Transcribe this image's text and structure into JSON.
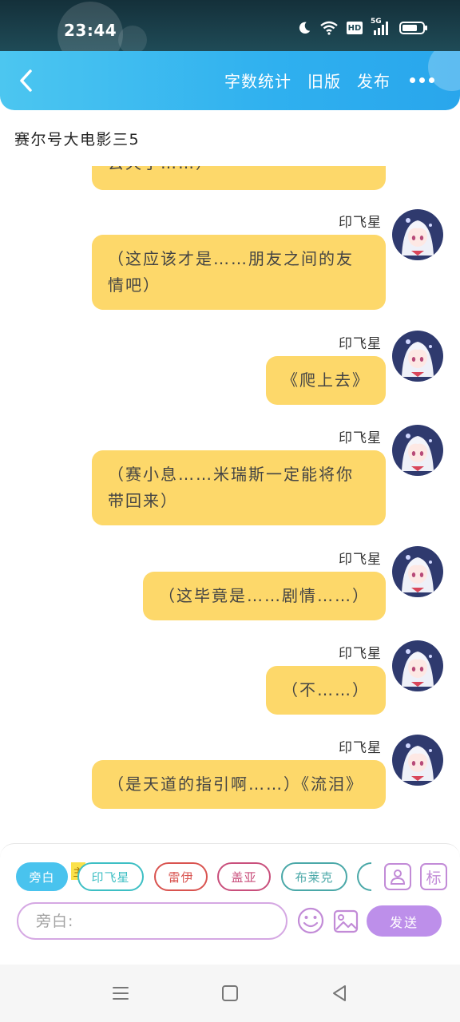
{
  "status_bar": {
    "time": "23:44",
    "hd_label": "HD",
    "network_label": "5G",
    "icons": [
      "moon-icon",
      "wifi-icon",
      "hd-icon",
      "signal-5g-icon",
      "battery-icon"
    ]
  },
  "header": {
    "back_icon": "chevron-left-icon",
    "actions": {
      "word_count": "字数统计",
      "old_version": "旧版",
      "publish": "发布"
    },
    "more_icon": "more-dots-icon",
    "colors": {
      "gradient_start": "#4cc6f0",
      "gradient_end": "#29a6ec"
    }
  },
  "project_title": "赛尔号大电影三5",
  "messages": [
    {
      "speaker": "",
      "text": "去天了……）",
      "partial": true
    },
    {
      "speaker": "印飞星",
      "text": "（这应该才是……朋友之间的友情吧）"
    },
    {
      "speaker": "印飞星",
      "text": "《爬上去》"
    },
    {
      "speaker": "印飞星",
      "text": "（赛小息……米瑞斯一定能将你带回来）"
    },
    {
      "speaker": "印飞星",
      "text": "（这毕竟是……剧情……）"
    },
    {
      "speaker": "印飞星",
      "text": "（不……）"
    },
    {
      "speaker": "印飞星",
      "text": "（是天道的指引啊……）《流泪》"
    }
  ],
  "bubble_color": "#fdd86a",
  "composer": {
    "chips": [
      {
        "label": "旁白",
        "active": true,
        "color": "#49c3ee"
      },
      {
        "label": "印飞星",
        "active": false,
        "color": "#3dbfc4"
      },
      {
        "label": "雷伊",
        "active": false,
        "color": "#d9534f"
      },
      {
        "label": "盖亚",
        "active": false,
        "color": "#c94f7c"
      },
      {
        "label": "布莱克",
        "active": false,
        "color": "#4aa8a8"
      }
    ],
    "main_tag": "主",
    "profile_icon": "person-card-icon",
    "mark_label": "标",
    "input_placeholder": "旁白:",
    "emoji_icon": "emoji-icon",
    "image_icon": "image-icon",
    "send_label": "发送"
  },
  "nav_bar": {
    "icons": [
      "menu-icon",
      "home-square-icon",
      "back-triangle-icon"
    ]
  }
}
